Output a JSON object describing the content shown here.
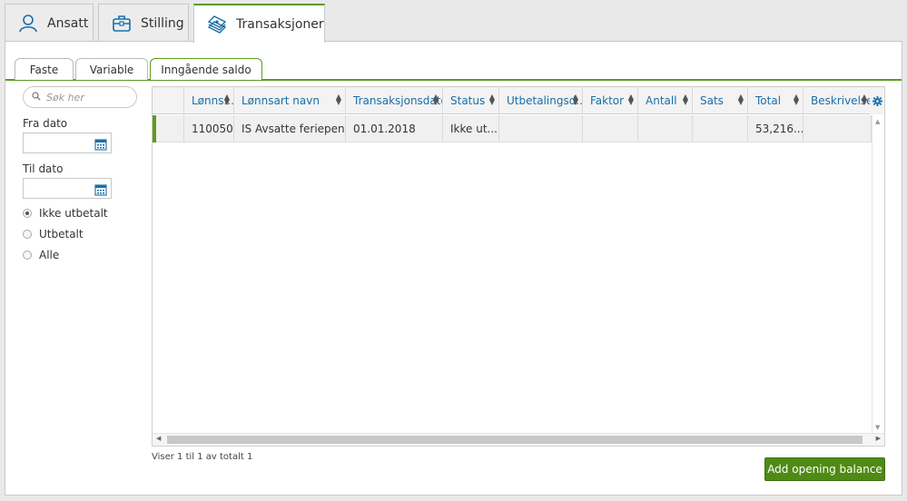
{
  "top_tabs": [
    {
      "label": "Ansatt",
      "icon": "user-icon"
    },
    {
      "label": "Stilling",
      "icon": "briefcase-icon"
    },
    {
      "label": "Transaksjoner",
      "icon": "money-stack-icon"
    }
  ],
  "sub_tabs": [
    "Faste",
    "Variable",
    "Inngående saldo"
  ],
  "filters": {
    "search_placeholder": "Søk her",
    "from_date_label": "Fra dato",
    "to_date_label": "Til dato",
    "radios": [
      "Ikke utbetalt",
      "Utbetalt",
      "Alle"
    ],
    "selected_radio": "Ikke utbetalt"
  },
  "grid": {
    "columns": [
      "Lønns...",
      "Lønnsart navn",
      "Transaksjonsdato",
      "Status",
      "Utbetalingsd...",
      "Faktor",
      "Antall",
      "Sats",
      "Total",
      "Beskrivelse"
    ],
    "rows": [
      [
        "110050",
        "IS Avsatte feriepen...",
        "01.01.2018",
        "Ikke ut...",
        "",
        "",
        "",
        "",
        "53,216...",
        ""
      ]
    ]
  },
  "footer_text": "Viser 1 til 1 av totalt 1",
  "add_button_label": "Add opening balance",
  "colors": {
    "accent": "#5e9a20",
    "button": "#4f8a14",
    "link": "#1a6ea8"
  }
}
